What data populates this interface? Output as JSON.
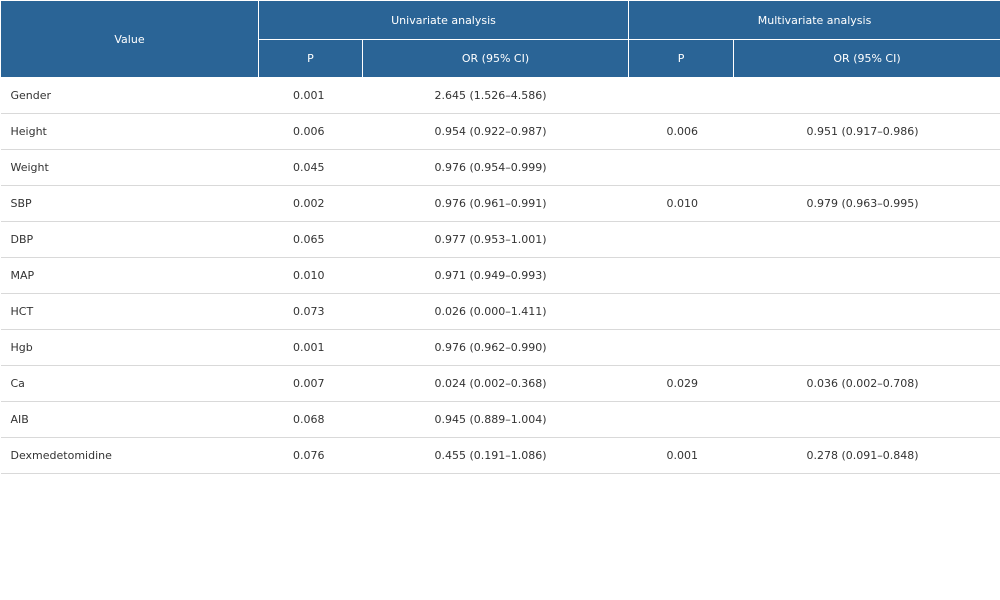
{
  "header": {
    "value_label": "Value",
    "univariate_label": "Univariate analysis",
    "multivariate_label": "Multivariate analysis",
    "p_label_uni": "P",
    "or_label_uni": "OR (95% CI)",
    "p_label_multi": "P",
    "or_label_multi": "OR (95% CI)"
  },
  "rows": [
    {
      "name": "Gender",
      "p_uni": "0.001",
      "or_uni": "2.645 (1.526–4.586)",
      "p_multi": "",
      "or_multi": ""
    },
    {
      "name": "Height",
      "p_uni": "0.006",
      "or_uni": "0.954 (0.922–0.987)",
      "p_multi": "0.006",
      "or_multi": "0.951 (0.917–0.986)"
    },
    {
      "name": "Weight",
      "p_uni": "0.045",
      "or_uni": "0.976 (0.954–0.999)",
      "p_multi": "",
      "or_multi": ""
    },
    {
      "name": "SBP",
      "p_uni": "0.002",
      "or_uni": "0.976 (0.961–0.991)",
      "p_multi": "0.010",
      "or_multi": "0.979 (0.963–0.995)"
    },
    {
      "name": "DBP",
      "p_uni": "0.065",
      "or_uni": "0.977 (0.953–1.001)",
      "p_multi": "",
      "or_multi": ""
    },
    {
      "name": "MAP",
      "p_uni": "0.010",
      "or_uni": "0.971 (0.949–0.993)",
      "p_multi": "",
      "or_multi": ""
    },
    {
      "name": "HCT",
      "p_uni": "0.073",
      "or_uni": "0.026 (0.000–1.411)",
      "p_multi": "",
      "or_multi": ""
    },
    {
      "name": "Hgb",
      "p_uni": "0.001",
      "or_uni": "0.976 (0.962–0.990)",
      "p_multi": "",
      "or_multi": ""
    },
    {
      "name": "Ca",
      "p_uni": "0.007",
      "or_uni": "0.024 (0.002–0.368)",
      "p_multi": "0.029",
      "or_multi": "0.036 (0.002–0.708)"
    },
    {
      "name": "AIB",
      "p_uni": "0.068",
      "or_uni": "0.945 (0.889–1.004)",
      "p_multi": "",
      "or_multi": ""
    },
    {
      "name": "Dexmedetomidine",
      "p_uni": "0.076",
      "or_uni": "0.455 (0.191–1.086)",
      "p_multi": "0.001",
      "or_multi": "0.278 (0.091–0.848)"
    }
  ]
}
